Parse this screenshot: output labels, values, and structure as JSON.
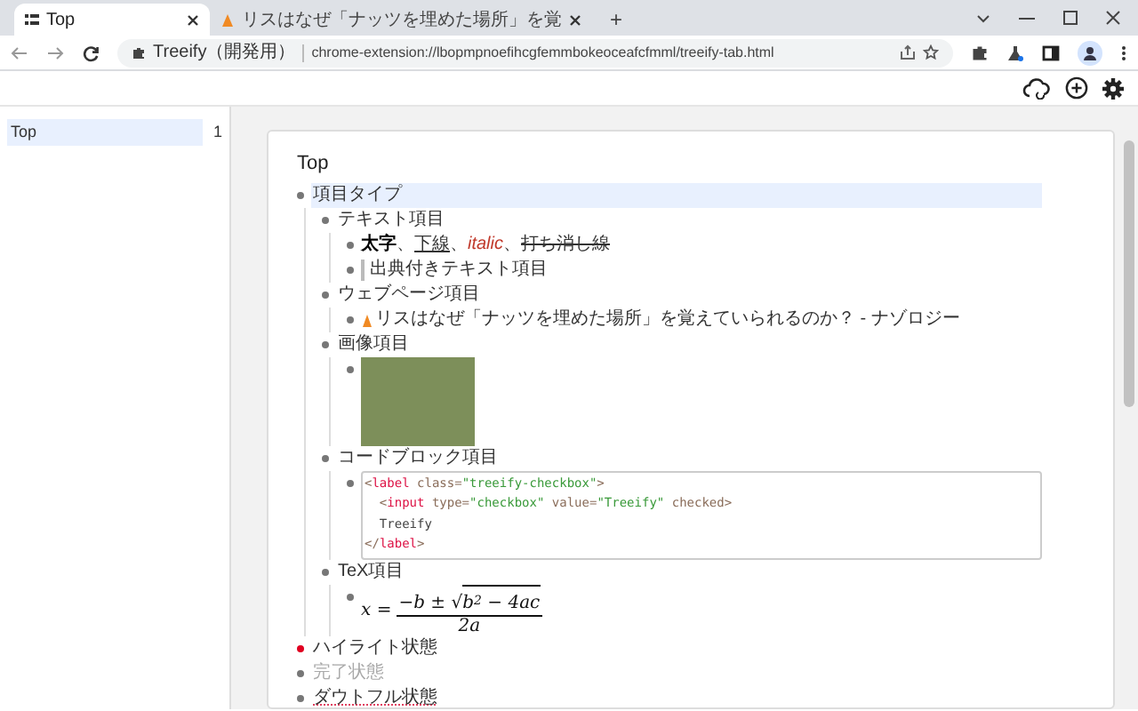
{
  "browser": {
    "tabs": [
      {
        "title": "Top",
        "selected": true
      },
      {
        "title": "リスはなぜ「ナッツを埋めた場所」を覚",
        "selected": false
      }
    ],
    "new_tab": "+",
    "site_chip": "Treeify（開発用）",
    "url": "chrome-extension://lbopmpnoefihcgfemmbokeoceafcfmml/treeify-tab.html"
  },
  "sidebar": {
    "items": [
      {
        "label": "Top",
        "count": "1",
        "selected": true
      }
    ]
  },
  "page": {
    "title": "Top",
    "items": [
      {
        "kind": "text",
        "text": "項目タイプ",
        "selected": true,
        "highlighted": false,
        "completed": false,
        "doubtful": false,
        "children": [
          {
            "kind": "text",
            "text": "テキスト項目",
            "children": [
              {
                "kind": "styled",
                "segments": [
                  {
                    "text": "太字",
                    "kind": "bold"
                  },
                  {
                    "text": "、",
                    "kind": "plain"
                  },
                  {
                    "text": "下線",
                    "kind": "underline"
                  },
                  {
                    "text": "、",
                    "kind": "plain"
                  },
                  {
                    "text": "italic",
                    "kind": "italic"
                  },
                  {
                    "text": "、",
                    "kind": "plain"
                  },
                  {
                    "text": "打ち消し線",
                    "kind": "strike"
                  }
                ]
              },
              {
                "kind": "citation",
                "text": "出典付きテキスト項目"
              }
            ]
          },
          {
            "kind": "text",
            "text": "ウェブページ項目",
            "children": [
              {
                "kind": "web",
                "text": "リスはなぜ「ナッツを埋めた場所」を覚えていられるのか？ - ナゾロジー"
              }
            ]
          },
          {
            "kind": "text",
            "text": "画像項目",
            "children": [
              {
                "kind": "image"
              }
            ]
          },
          {
            "kind": "text",
            "text": "コードブロック項目",
            "children": [
              {
                "kind": "code",
                "lines": [
                  [
                    {
                      "text": "<",
                      "kind": "punct"
                    },
                    {
                      "text": "label",
                      "kind": "tag"
                    },
                    {
                      "text": " class=",
                      "kind": "attr"
                    },
                    {
                      "text": "\"treeify-checkbox\"",
                      "kind": "string"
                    },
                    {
                      "text": ">",
                      "kind": "punct"
                    }
                  ],
                  [
                    {
                      "text": "  <",
                      "kind": "punct"
                    },
                    {
                      "text": "input",
                      "kind": "tag"
                    },
                    {
                      "text": " type=",
                      "kind": "attr"
                    },
                    {
                      "text": "\"checkbox\"",
                      "kind": "string"
                    },
                    {
                      "text": " value=",
                      "kind": "attr"
                    },
                    {
                      "text": "\"Treeify\"",
                      "kind": "string"
                    },
                    {
                      "text": " checked>",
                      "kind": "attr"
                    }
                  ],
                  [
                    {
                      "text": "  Treeify",
                      "kind": "text"
                    }
                  ],
                  [
                    {
                      "text": "</",
                      "kind": "punct"
                    },
                    {
                      "text": "label",
                      "kind": "tag"
                    },
                    {
                      "text": ">",
                      "kind": "punct"
                    }
                  ]
                ]
              }
            ]
          },
          {
            "kind": "text",
            "text": "TeX項目",
            "children": [
              {
                "kind": "tex",
                "lhs": "x =",
                "numerator": "−b ±",
                "radical": "√",
                "radicand": "b$^{2}$ − 4ac",
                "denominator": "2a"
              }
            ]
          }
        ]
      },
      {
        "kind": "text",
        "text": "ハイライト状態",
        "selected": false,
        "highlighted": true,
        "completed": false,
        "doubtful": false
      },
      {
        "kind": "text",
        "text": "完了状態",
        "selected": false,
        "highlighted": false,
        "completed": true,
        "doubtful": false
      },
      {
        "kind": "text",
        "text": "ダウトフル状態",
        "selected": false,
        "highlighted": false,
        "completed": false,
        "doubtful": true
      }
    ]
  }
}
